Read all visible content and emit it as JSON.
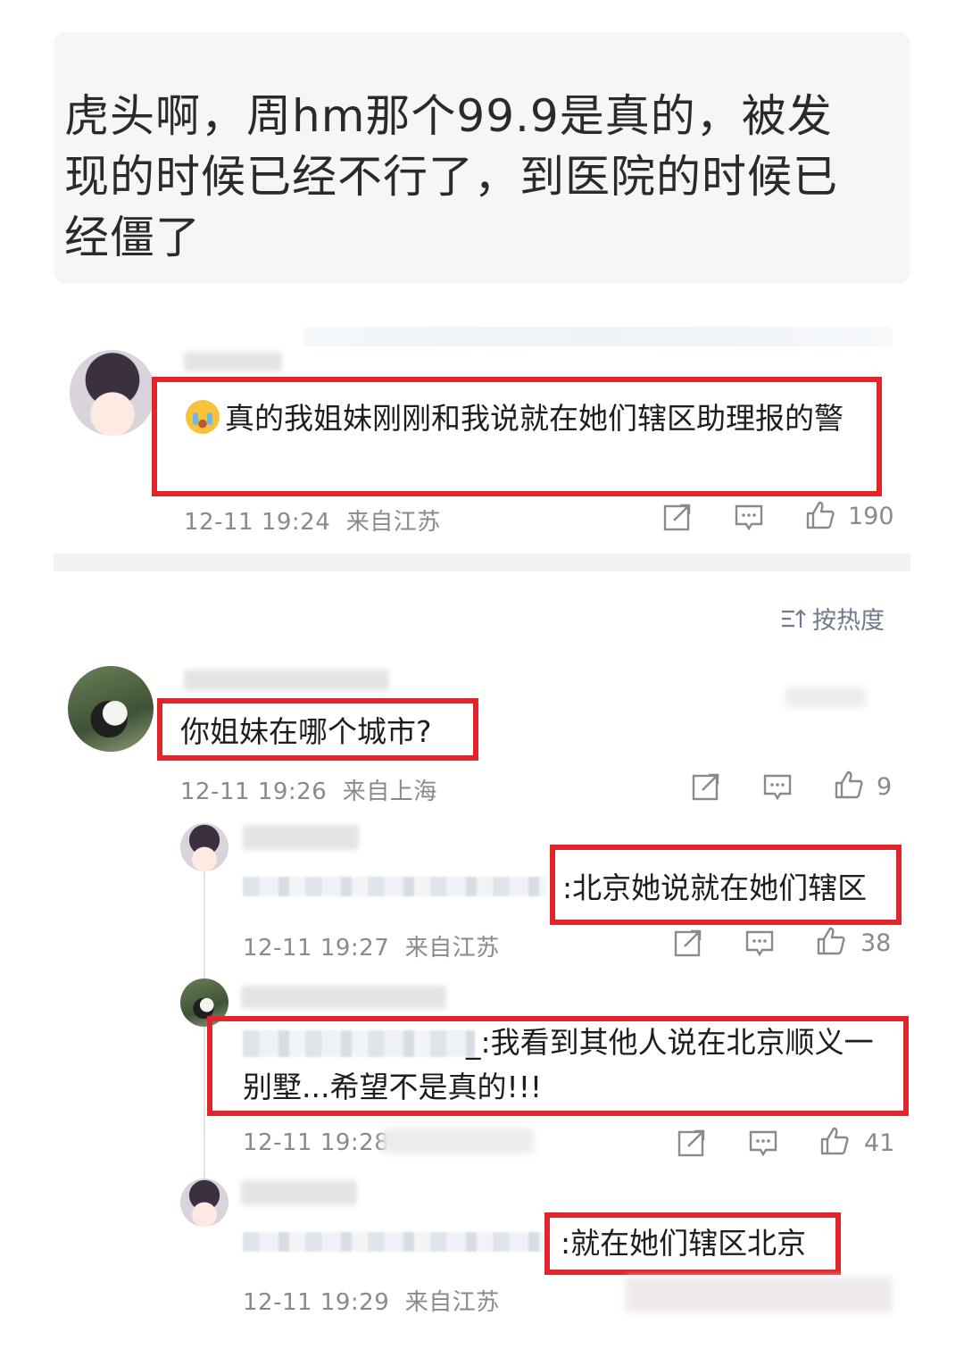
{
  "quote": {
    "text": "虎头啊，周hm那个99.9是真的，被发现的时候已经不行了，到医院的时候已经僵了"
  },
  "main_comment": {
    "emoji": "crying-face",
    "text": "真的我姐妹刚刚和我说就在她们辖区助理报的警",
    "time": "12-11 19:24",
    "location": "来自江苏",
    "likes": "190"
  },
  "sort": {
    "label": "按热度"
  },
  "comments": [
    {
      "text": "你姐妹在哪个城市?",
      "time": "12-11 19:26",
      "location": "来自上海",
      "likes": "9"
    }
  ],
  "replies": [
    {
      "text": ":北京她说就在她们辖区",
      "time": "12-11 19:27",
      "location": "来自江苏",
      "likes": "38"
    },
    {
      "text": "_:我看到其他人说在北京顺义一别墅...希望不是真的!!!",
      "time": "12-11 19:28",
      "location": "",
      "likes": "41"
    },
    {
      "text": ":就在她们辖区北京",
      "time": "12-11 19:29",
      "location": "来自江苏",
      "likes": ""
    }
  ],
  "colors": {
    "highlight": "#e0262a",
    "meta": "#8a8a8a",
    "sort": "#6e7b8c"
  }
}
